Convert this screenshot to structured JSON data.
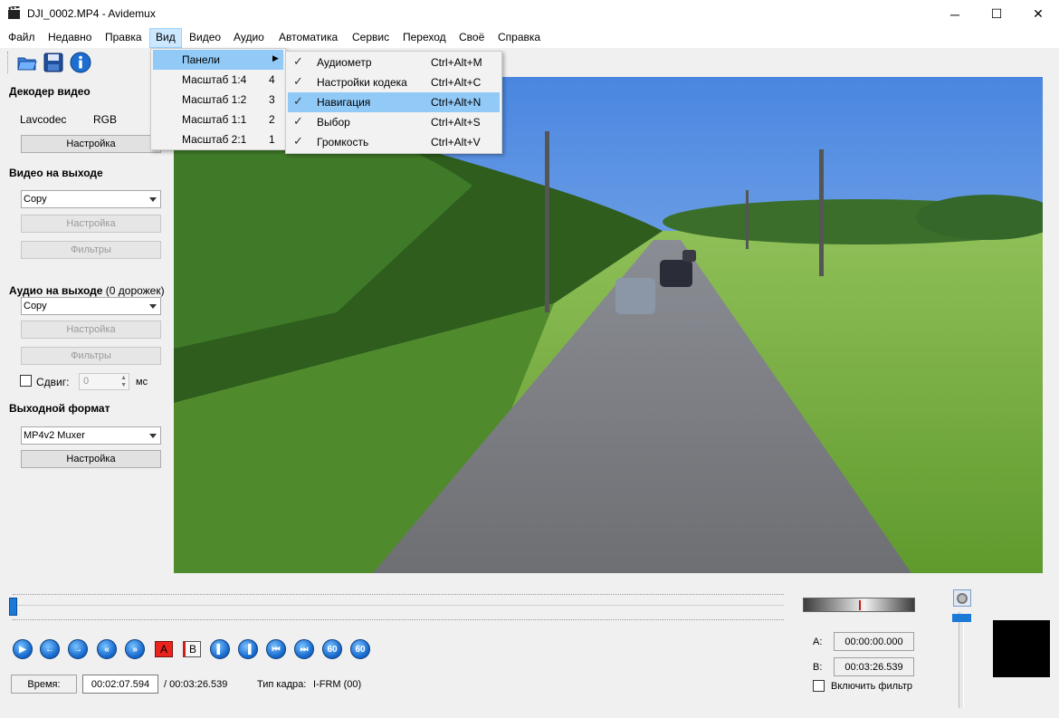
{
  "window": {
    "title": "DJI_0002.MP4 - Avidemux",
    "min": "─",
    "max": "☐",
    "close": "✕"
  },
  "menubar": [
    "Файл",
    "Недавно",
    "Правка",
    "Вид",
    "Видео",
    "Аудио",
    "Автоматика",
    "Сервис",
    "Переход",
    "Своё",
    "Справка"
  ],
  "view_menu": {
    "items": [
      {
        "label": "Панели",
        "key": ""
      },
      {
        "label": "Масштаб 1:4",
        "key": "4"
      },
      {
        "label": "Масштаб 1:2",
        "key": "3"
      },
      {
        "label": "Масштаб 1:1",
        "key": "2"
      },
      {
        "label": "Масштаб 2:1",
        "key": "1"
      }
    ]
  },
  "panels_menu": {
    "items": [
      {
        "label": "Аудиометр",
        "key": "Ctrl+Alt+M",
        "checked": true
      },
      {
        "label": "Настройки кодека",
        "key": "Ctrl+Alt+C",
        "checked": true
      },
      {
        "label": "Навигация",
        "key": "Ctrl+Alt+N",
        "checked": true
      },
      {
        "label": "Выбор",
        "key": "Ctrl+Alt+S",
        "checked": true
      },
      {
        "label": "Громкость",
        "key": "Ctrl+Alt+V",
        "checked": true
      }
    ]
  },
  "left": {
    "decoder_title": "Декодер видео",
    "decoder_name": "Lavcodec",
    "decoder_fmt": "RGB",
    "decoder_cfg": "Настройка",
    "video_out_title": "Видео на выходе",
    "video_codec": "Copy",
    "video_cfg": "Настройка",
    "video_filters": "Фильтры",
    "audio_out_title": "Аудио на выходе",
    "audio_tracks": "(0 дорожек)",
    "audio_codec": "Copy",
    "audio_cfg": "Настройка",
    "audio_filters": "Фильтры",
    "shift_label": "Сдвиг:",
    "shift_value": "0",
    "shift_unit": "мс",
    "format_title": "Выходной формат",
    "muxer": "MP4v2 Muxer",
    "muxer_cfg": "Настройка"
  },
  "bottom": {
    "time_btn": "Время:",
    "current_time": "00:02:07.594",
    "total_time": "/ 00:03:26.539",
    "frame_type_label": "Тип кадра:",
    "frame_type": "I-FRM (00)",
    "a_label": "A:",
    "a_time": "00:00:00.000",
    "b_label": "B:",
    "b_time": "00:03:26.539",
    "filter_label": "Включить фильтр",
    "nav_a": "A",
    "nav_b": "B",
    "nav_60": "60",
    "progress_fraction": 0.0
  }
}
